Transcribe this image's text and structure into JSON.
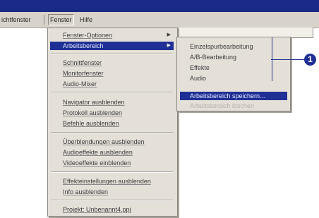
{
  "menubar": {
    "prev_item": "ichtfenster",
    "fenster": "Fenster",
    "hilfe": "Hilfe"
  },
  "fenster_menu": {
    "items": [
      {
        "label": "Fenster-Optionen",
        "submenu": true
      },
      {
        "label": "Arbeitsbereich",
        "submenu": true,
        "selected": true
      },
      {
        "label": "Schnittfenster"
      },
      {
        "label": "Monitorfenster"
      },
      {
        "label": "Audio-Mixer"
      },
      {
        "label": "Navigator ausblenden"
      },
      {
        "label": "Protokoll ausblenden"
      },
      {
        "label": "Befehle ausblenden"
      },
      {
        "label": "Überblendungen ausblenden"
      },
      {
        "label": "Audioeffekte ausblenden"
      },
      {
        "label": "Videoeffekte einblenden"
      },
      {
        "label": "Effekteinstellungen ausblenden"
      },
      {
        "label": "Info ausblenden"
      },
      {
        "label": "Projekt: Unbenannt4.ppj"
      }
    ]
  },
  "arbeitsbereich_submenu": {
    "items": [
      {
        "label": "Einzelspurbearbeitung"
      },
      {
        "label": "A/B-Bearbeitung"
      },
      {
        "label": "Effekte"
      },
      {
        "label": "Audio"
      },
      {
        "label": "Arbeitsbereich speichern...",
        "selected": true
      },
      {
        "label": "Arbeitsbereich löschen",
        "disabled": true
      }
    ]
  },
  "callout": {
    "number": "1"
  }
}
